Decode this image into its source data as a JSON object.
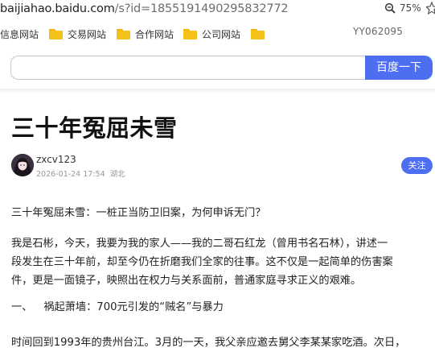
{
  "browser": {
    "url_host": "baijiahao.baidu.com",
    "url_path": "/s?id=1855191490295832772",
    "zoom": "75%"
  },
  "bookmarks": {
    "items": [
      {
        "label": "信息网站",
        "icon": "folder-icon"
      },
      {
        "label": "交易网站",
        "icon": "folder-icon"
      },
      {
        "label": "合作网站",
        "icon": "folder-icon"
      },
      {
        "label": "公司网站",
        "icon": "folder-icon"
      }
    ],
    "user": "YY062095"
  },
  "search": {
    "placeholder": "",
    "button_label": "百度一下",
    "accent_color": "#4e6ef2"
  },
  "article": {
    "title": "三十年冤屈未雪",
    "author": "zxcv123",
    "date": "2026-01-24 17:54",
    "location": "湖北",
    "follow_label": "关注",
    "paragraphs": [
      "三十年冤屈未雪：一桩正当防卫旧案，为何申诉无门？",
      "我是石彬，今天，我要为我的家人——我的二哥石红龙（曾用书名石林），讲述一",
      "段发生在三十年前，却至今仍在折磨我们全家的往事。这不仅是一起简单的伤害案",
      "件，更是一面镜子，映照出在权力与关系面前，普通家庭寻求正义的艰难。"
    ],
    "section": {
      "mark": "一、",
      "heading": "祸起萧墙：700元引发的“贼名”与暴力"
    },
    "last_line": "时间回到1993年的贵州台江。3月的一天，我父亲应邀去舅父李某某家吃酒。次日，"
  }
}
